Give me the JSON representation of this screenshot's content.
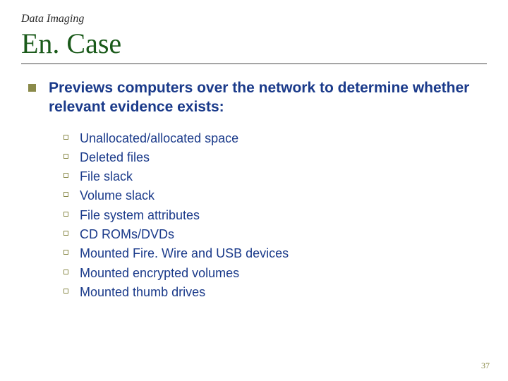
{
  "section_label": "Data Imaging",
  "title": "En. Case",
  "main_bullet": "Previews computers over the network to determine whether relevant evidence exists:",
  "sub_items": [
    "Unallocated/allocated space",
    "Deleted files",
    "File slack",
    "Volume slack",
    "File system attributes",
    "CD ROMs/DVDs",
    "Mounted Fire. Wire and USB devices",
    "Mounted encrypted volumes",
    "Mounted thumb drives"
  ],
  "page_number": "37"
}
